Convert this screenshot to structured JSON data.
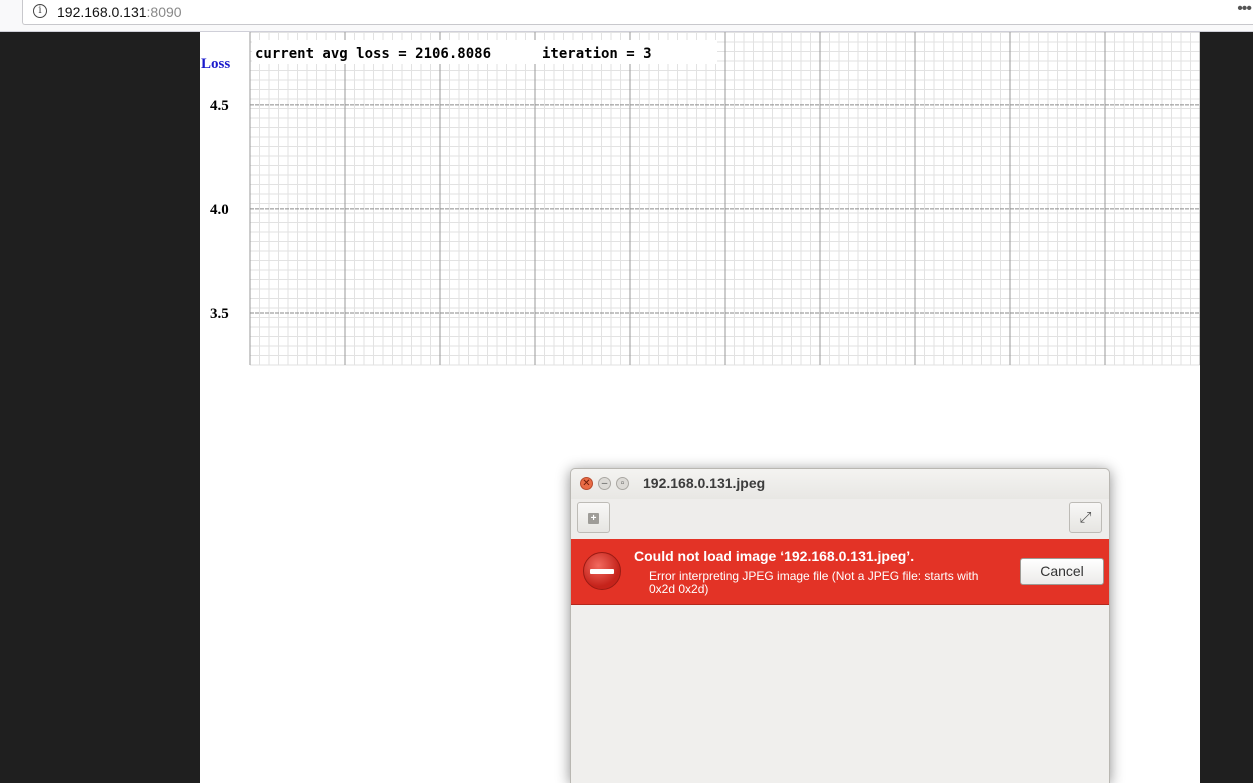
{
  "browser": {
    "url_host": "192.168.0.131",
    "url_port": ":8090",
    "info_icon": "i",
    "more_icon": "•••"
  },
  "chart_data": {
    "type": "line",
    "ylabel": "Loss",
    "ylim": [
      3.25,
      4.85
    ],
    "y_ticks": [
      "4.5",
      "4.0",
      "3.5"
    ],
    "grid": true,
    "series": [],
    "annotation": {
      "loss_text": "current avg loss = 2106.8086",
      "iteration_text": "iteration = 3"
    }
  },
  "dialog": {
    "title": "192.168.0.131.jpeg",
    "error_title": "Could not load image ‘192.168.0.131.jpeg’.",
    "error_detail": "Error interpreting JPEG image file (Not a JPEG file: starts with 0x2d 0x2d)",
    "cancel_label": "Cancel",
    "close_glyph": "✕",
    "minimize_glyph": "–",
    "maximize_glyph": "▫",
    "add_glyph": "+",
    "fullscreen_glyph": "⤢",
    "icons": [
      "error-icon",
      "add-icon",
      "fullscreen-icon"
    ],
    "error_color": "#e33326"
  }
}
